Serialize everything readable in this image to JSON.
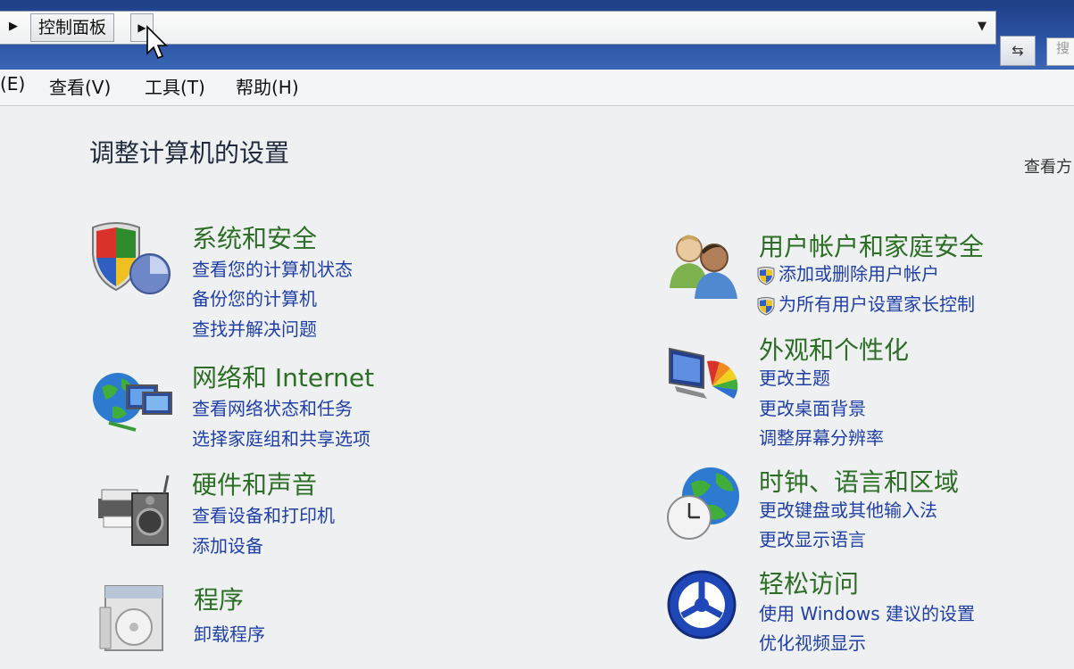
{
  "breadcrumb": {
    "item": "控制面板"
  },
  "menu": [
    "(E)",
    "查看(V)",
    "工具(T)",
    "帮助(H)"
  ],
  "search": {
    "partial_text": "搜"
  },
  "page": {
    "title": "调整计算机的设置",
    "view_by": "查看方"
  },
  "categories": {
    "system": {
      "title": "系统和安全",
      "links": [
        "查看您的计算机状态",
        "备份您的计算机",
        "查找并解决问题"
      ]
    },
    "network": {
      "title": "网络和 Internet",
      "links": [
        "查看网络状态和任务",
        "选择家庭组和共享选项"
      ]
    },
    "hardware": {
      "title": "硬件和声音",
      "links": [
        "查看设备和打印机",
        "添加设备"
      ]
    },
    "programs": {
      "title": "程序",
      "links": [
        "卸载程序"
      ]
    },
    "users": {
      "title": "用户帐户和家庭安全",
      "links": [
        "添加或删除用户帐户",
        "为所有用户设置家长控制"
      ]
    },
    "appearance": {
      "title": "外观和个性化",
      "links": [
        "更改主题",
        "更改桌面背景",
        "调整屏幕分辨率"
      ]
    },
    "clock": {
      "title": "时钟、语言和区域",
      "links": [
        "更改键盘或其他输入法",
        "更改显示语言"
      ]
    },
    "ease": {
      "title": "轻松访问",
      "links": [
        "使用 Windows 建议的设置",
        "优化视频显示"
      ]
    }
  },
  "colors": {
    "category_title": "#2c6e25",
    "link": "#1f3fa6",
    "titlebar": "#2a53a3"
  }
}
